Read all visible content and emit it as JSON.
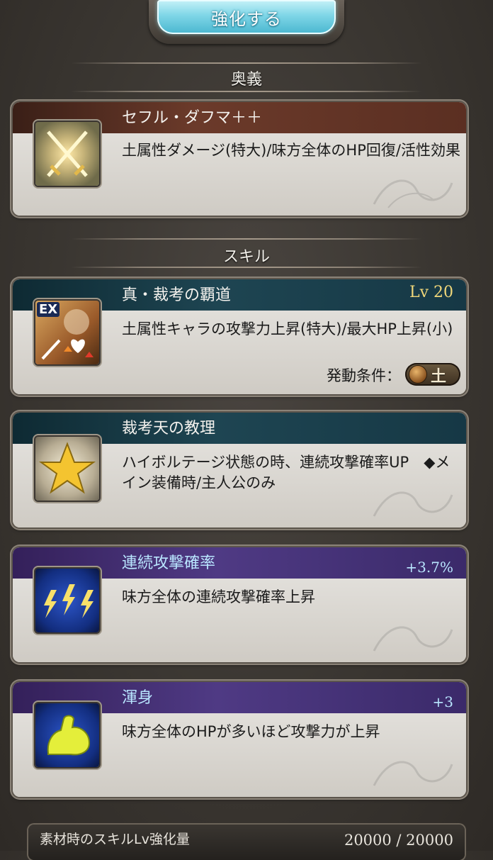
{
  "header": {
    "enhance_label": "強化する"
  },
  "sections": {
    "ougi_title": "奥義",
    "skill_title": "スキル"
  },
  "ougi": {
    "name": "セフル・ダフマ＋＋",
    "description": "土属性ダメージ(特大)/味方全体のHP回復/活性効果",
    "icon": "crossed-swords-icon"
  },
  "skills": [
    {
      "name": "真・裁考の覇道",
      "level": "Lv 20",
      "description": "土属性キャラの攻撃力上昇(特大)/最大HP上昇(小)",
      "condition_label": "発動条件：",
      "condition_element": "土",
      "icon": "ex-skill-icon",
      "badge": "EX"
    },
    {
      "name": "裁考天の教理",
      "description": "ハイボルテージ状態の時、連続攻撃確率UP　◆メイン装備時/主人公のみ",
      "icon": "star-icon"
    }
  ],
  "support_skills": [
    {
      "name": "連続攻撃確率",
      "bonus": "+3.7%",
      "description": "味方全体の連続攻撃確率上昇",
      "icon": "triple-lightning-icon"
    },
    {
      "name": "渾身",
      "bonus": "+3",
      "description": "味方全体のHPが多いほど攻撃力が上昇",
      "icon": "flexed-arm-icon"
    }
  ],
  "footer": {
    "label": "素材時のスキルLv強化量",
    "value": "20000 / 20000"
  },
  "colors": {
    "background": "#3a3631",
    "enhance_button": "#7fd6e7",
    "ougi_header": "#6b3a2a",
    "skill_header": "#1e4552",
    "support_header": "#4f3a84",
    "level_text": "#f0d77a",
    "bonus_text": "#b9e6ff"
  }
}
